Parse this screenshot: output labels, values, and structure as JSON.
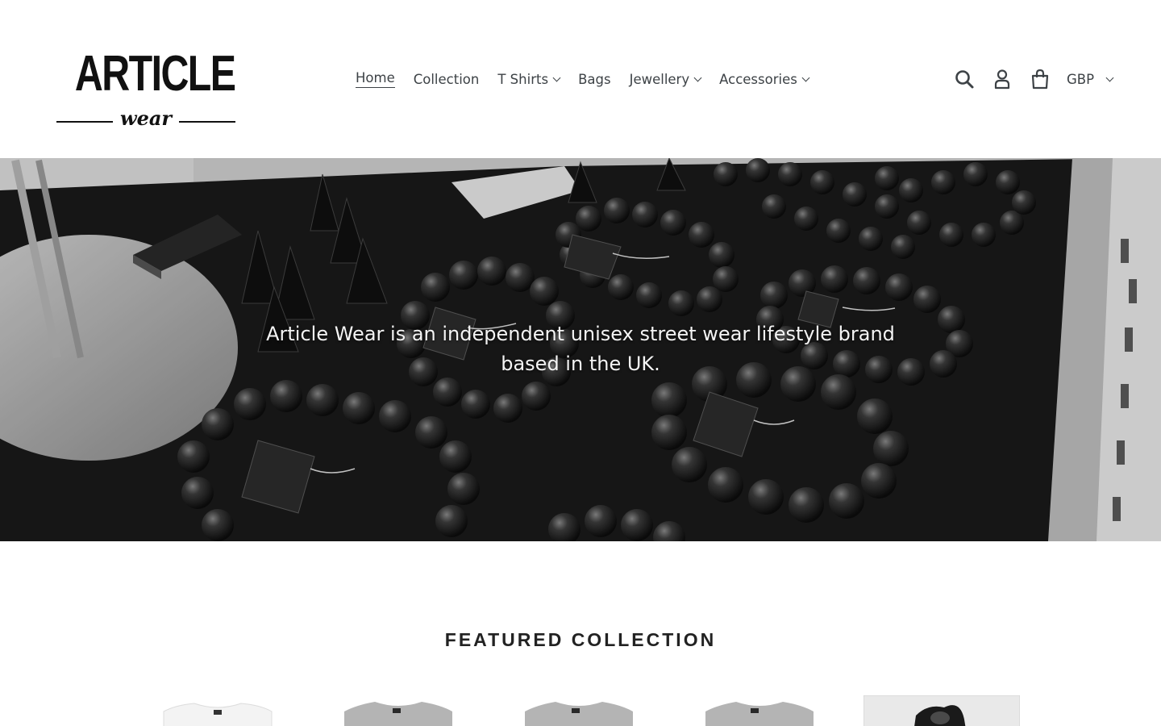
{
  "brand": {
    "logo_main": "ARTICLE",
    "logo_sub": "wear"
  },
  "nav": {
    "items": [
      {
        "label": "Home",
        "active": true,
        "dropdown": false
      },
      {
        "label": "Collection",
        "active": false,
        "dropdown": false
      },
      {
        "label": "T Shirts",
        "active": false,
        "dropdown": true
      },
      {
        "label": "Bags",
        "active": false,
        "dropdown": false
      },
      {
        "label": "Jewellery",
        "active": false,
        "dropdown": true
      },
      {
        "label": "Accessories",
        "active": false,
        "dropdown": true
      }
    ]
  },
  "header_icons": [
    "search-icon",
    "account-icon",
    "cart-icon"
  ],
  "currency": {
    "selected": "GBP"
  },
  "hero": {
    "text": "Article Wear is an independent unisex street wear lifestyle brand based in the UK.",
    "image_tone": "monochrome"
  },
  "featured": {
    "title": "FEATURED COLLECTION",
    "products": [
      {
        "kind": "tshirt",
        "shade": "white"
      },
      {
        "kind": "tshirt",
        "shade": "grey"
      },
      {
        "kind": "tshirt",
        "shade": "grey"
      },
      {
        "kind": "tshirt",
        "shade": "grey"
      },
      {
        "kind": "photo",
        "shade": "dark"
      }
    ]
  },
  "colors": {
    "text": "#3d4246",
    "background": "#ffffff",
    "hero_text": "#f4f4f4"
  }
}
